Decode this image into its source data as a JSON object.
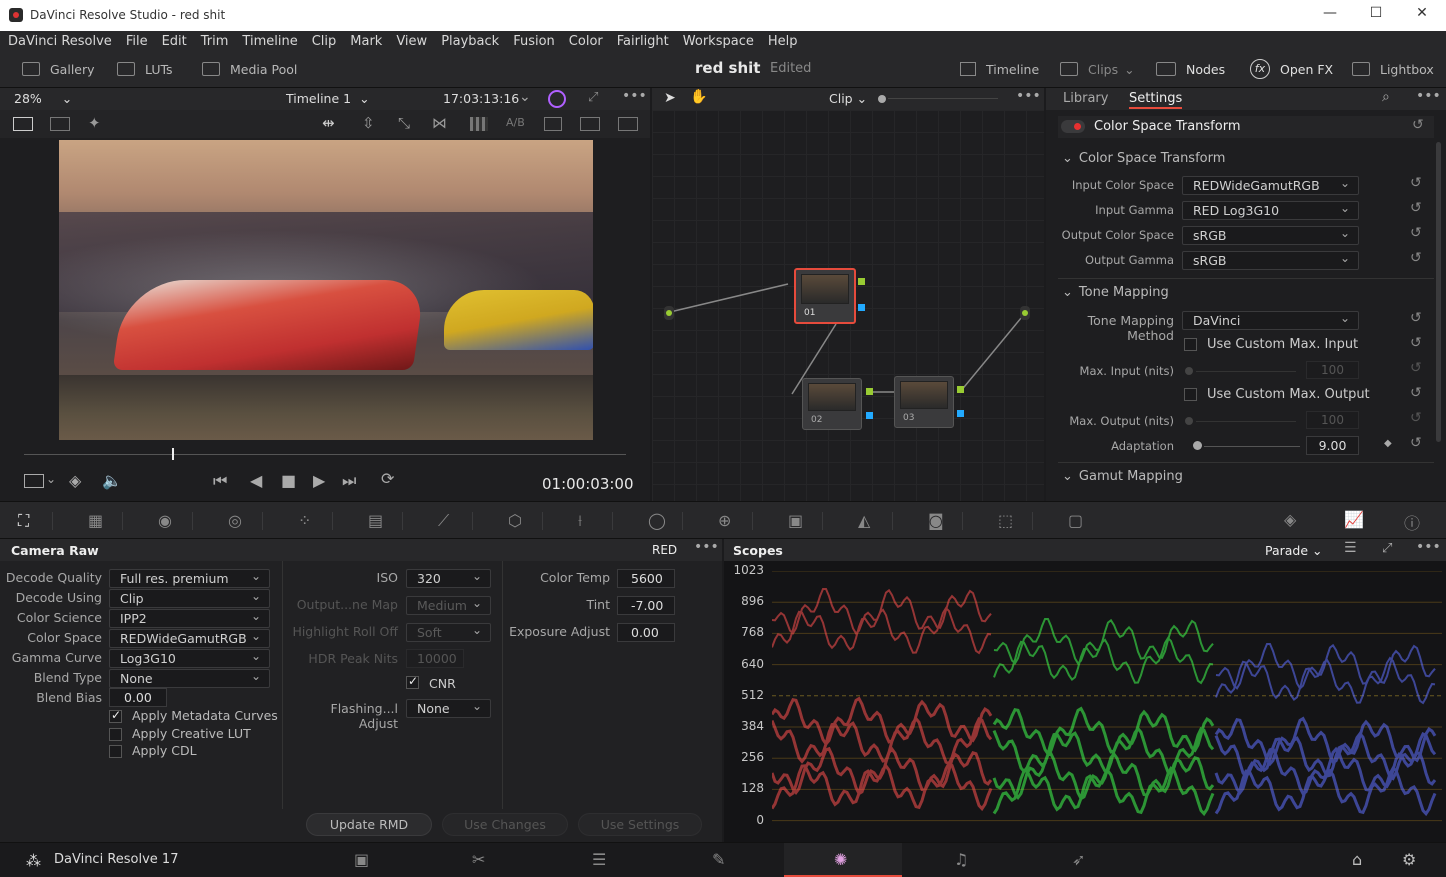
{
  "window": {
    "title": "DaVinci Resolve Studio - red shit"
  },
  "menu": [
    "DaVinci Resolve",
    "File",
    "Edit",
    "Trim",
    "Timeline",
    "Clip",
    "Mark",
    "View",
    "Playback",
    "Fusion",
    "Color",
    "Fairlight",
    "Workspace",
    "Help"
  ],
  "toolbar": {
    "gallery": "Gallery",
    "luts": "LUTs",
    "media_pool": "Media Pool",
    "project": "red shit",
    "status": "Edited",
    "timeline": "Timeline",
    "clips": "Clips",
    "nodes": "Nodes",
    "openfx": "Open FX",
    "lightbox": "Lightbox"
  },
  "viewer": {
    "zoom": "28%",
    "timeline_name": "Timeline 1",
    "timecode_top": "17:03:13:16",
    "ab_label": "A/B",
    "timecode": "01:00:03:00"
  },
  "node_editor": {
    "mode": "Clip",
    "nodes": [
      "01",
      "02",
      "03"
    ]
  },
  "inspector": {
    "tabs": [
      "Library",
      "Settings"
    ],
    "effect_title": "Color Space Transform",
    "section1": "Color Space Transform",
    "fields": [
      {
        "label": "Input Color Space",
        "value": "REDWideGamutRGB"
      },
      {
        "label": "Input Gamma",
        "value": "RED Log3G10"
      },
      {
        "label": "Output Color Space",
        "value": "sRGB"
      },
      {
        "label": "Output Gamma",
        "value": "sRGB"
      }
    ],
    "section2": "Tone Mapping",
    "tm_method_label": "Tone Mapping Method",
    "tm_method": "DaVinci",
    "use_custom_input": "Use Custom Max. Input",
    "max_input_label": "Max. Input (nits)",
    "max_input": "100",
    "use_custom_output": "Use Custom Max. Output",
    "max_output_label": "Max. Output (nits)",
    "max_output": "100",
    "adaptation_label": "Adaptation",
    "adaptation": "9.00",
    "section3": "Gamut Mapping"
  },
  "camera_raw": {
    "title": "Camera Raw",
    "format": "RED",
    "left": [
      {
        "label": "Decode Quality",
        "value": "Full res. premium"
      },
      {
        "label": "Decode Using",
        "value": "Clip"
      },
      {
        "label": "Color Science",
        "value": "IPP2"
      },
      {
        "label": "Color Space",
        "value": "REDWideGamutRGB"
      },
      {
        "label": "Gamma Curve",
        "value": "Log3G10"
      },
      {
        "label": "Blend Type",
        "value": "None"
      }
    ],
    "blend_bias_label": "Blend Bias",
    "blend_bias": "0.00",
    "checks": [
      {
        "label": "Apply Metadata Curves",
        "on": true
      },
      {
        "label": "Apply Creative LUT",
        "on": false
      },
      {
        "label": "Apply CDL",
        "on": false
      }
    ],
    "mid": [
      {
        "label": "ISO",
        "value": "320",
        "dis": false
      },
      {
        "label": "Output...ne Map",
        "value": "Medium",
        "dis": true
      },
      {
        "label": "Highlight Roll Off",
        "value": "Soft",
        "dis": true
      }
    ],
    "hdr_label": "HDR Peak Nits",
    "hdr": "10000",
    "cnr": "CNR",
    "flash_label": "Flashing...l Adjust",
    "flash": "None",
    "right": [
      {
        "label": "Color Temp",
        "value": "5600"
      },
      {
        "label": "Tint",
        "value": "-7.00"
      },
      {
        "label": "Exposure Adjust",
        "value": "0.00"
      }
    ],
    "buttons": [
      "Update RMD",
      "Use Changes",
      "Use Settings"
    ]
  },
  "scopes": {
    "title": "Scopes",
    "mode": "Parade",
    "ticks": [
      "1023",
      "896",
      "768",
      "640",
      "512",
      "384",
      "256",
      "128",
      "0"
    ]
  },
  "footer": {
    "app": "DaVinci Resolve 17"
  },
  "colors": {
    "accent": "#e64b3c",
    "red": "#ff5050",
    "green": "#40ff50",
    "blue": "#6070ff"
  }
}
